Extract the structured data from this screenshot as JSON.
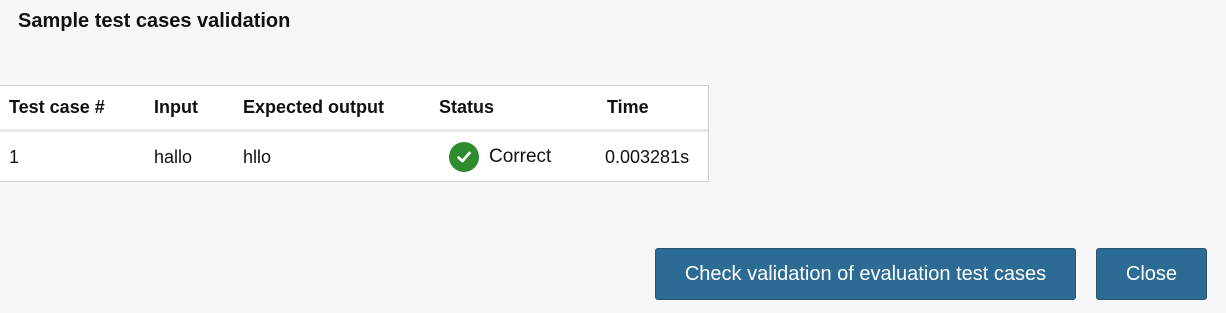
{
  "dialog": {
    "title": "Sample test cases validation"
  },
  "table": {
    "headers": {
      "test_case": "Test case #",
      "input": "Input",
      "expected_output": "Expected output",
      "status": "Status",
      "time": "Time"
    },
    "rows": [
      {
        "test_case": "1",
        "input": "hallo",
        "expected_output": "hllo",
        "status": "Correct",
        "status_icon": "check-circle-icon",
        "time": "0.003281s"
      }
    ]
  },
  "buttons": {
    "check_validation": "Check validation of evaluation test cases",
    "close": "Close"
  },
  "colors": {
    "button_bg": "#2c6b94",
    "success": "#2e8b2e",
    "background": "#f7f7f7"
  }
}
